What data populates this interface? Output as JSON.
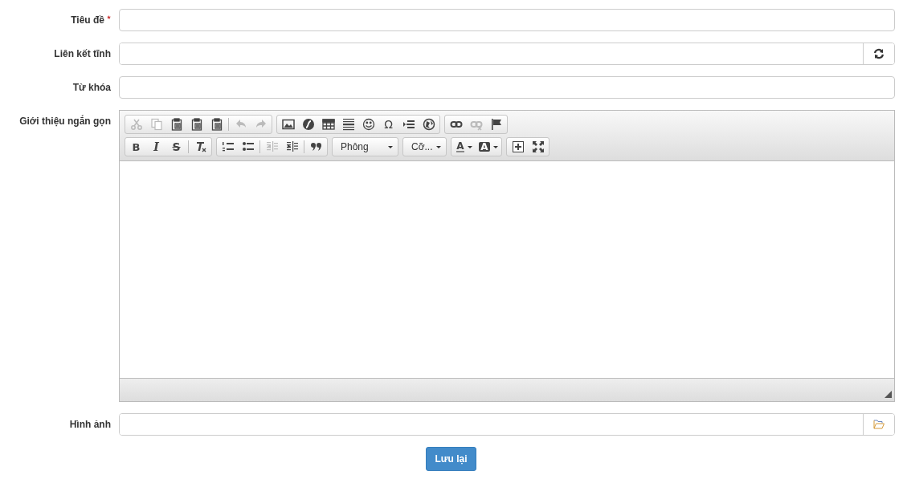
{
  "fields": [
    {
      "label": "Tiêu đề",
      "required": true,
      "kind": "text"
    },
    {
      "label": "Liên kết tĩnh",
      "required": false,
      "kind": "refresh"
    },
    {
      "label": "Từ khóa",
      "required": false,
      "kind": "text"
    }
  ],
  "editor": {
    "label": "Giới thiệu ngắn gọn",
    "toolbar": [
      [
        [
          {
            "kind": "cut",
            "disabled": true
          },
          {
            "kind": "copy",
            "disabled": true
          },
          {
            "kind": "paste",
            "disabled": false
          },
          {
            "kind": "paste-text",
            "disabled": false
          },
          {
            "kind": "paste-word",
            "disabled": false
          },
          {
            "kind": "separator"
          },
          {
            "kind": "undo",
            "disabled": true
          },
          {
            "kind": "redo",
            "disabled": true
          }
        ],
        [
          {
            "kind": "image",
            "disabled": false
          },
          {
            "kind": "flash",
            "disabled": false
          },
          {
            "kind": "table",
            "disabled": false
          },
          {
            "kind": "hr",
            "disabled": false
          },
          {
            "kind": "smiley",
            "disabled": false
          },
          {
            "kind": "glyph",
            "glyph": "Ω",
            "disabled": false
          },
          {
            "kind": "pagebreak",
            "disabled": false
          },
          {
            "kind": "globe",
            "disabled": false
          }
        ],
        [
          {
            "kind": "link",
            "disabled": false
          },
          {
            "kind": "unlink",
            "disabled": true
          },
          {
            "kind": "flag",
            "disabled": false
          }
        ]
      ],
      [
        [
          {
            "kind": "bold",
            "glyph": "B",
            "disabled": false
          },
          {
            "kind": "italic",
            "glyph": "I",
            "disabled": false
          },
          {
            "kind": "strike",
            "glyph": "S",
            "disabled": false
          },
          {
            "kind": "separator"
          },
          {
            "kind": "clear",
            "disabled": false
          }
        ],
        [
          {
            "kind": "ol",
            "disabled": false
          },
          {
            "kind": "ul",
            "disabled": false
          },
          {
            "kind": "separator"
          },
          {
            "kind": "outdent",
            "disabled": true
          },
          {
            "kind": "indent",
            "disabled": false
          },
          {
            "kind": "separator"
          },
          {
            "kind": "quote",
            "disabled": false
          }
        ],
        [
          {
            "kind": "combo",
            "label": "Phông"
          }
        ],
        [
          {
            "kind": "combo",
            "label": "Cỡ..."
          }
        ],
        [
          {
            "kind": "textcolor",
            "glyph": "A",
            "disabled": false
          },
          {
            "kind": "bgcolor",
            "glyph": "A",
            "disabled": false
          }
        ],
        [
          {
            "kind": "blocks",
            "disabled": false
          },
          {
            "kind": "maximize",
            "disabled": false
          }
        ]
      ]
    ]
  },
  "image_field": {
    "label": "Hình ảnh"
  },
  "save_button": "Lưu lại"
}
